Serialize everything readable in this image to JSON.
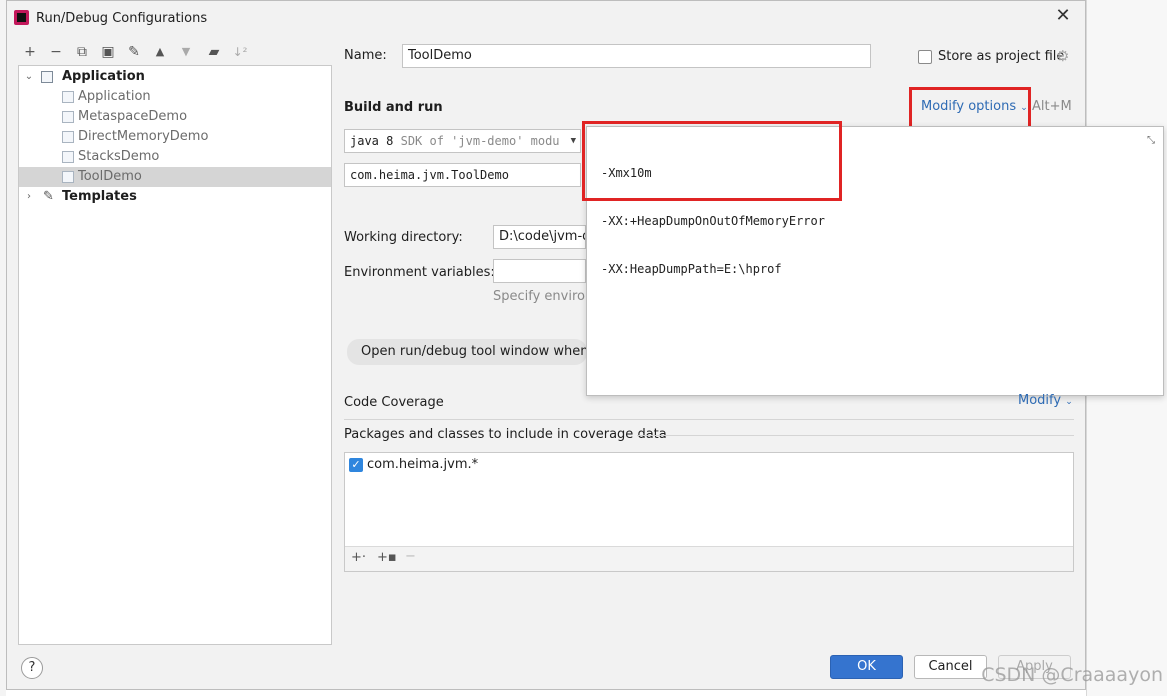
{
  "window": {
    "title": "Run/Debug Configurations",
    "close_glyph": "✕"
  },
  "toolbar": {
    "add": "+",
    "remove": "−",
    "copy": "⧉",
    "save": "▣",
    "edit": "✎",
    "up": "▲",
    "down": "▼",
    "folder": "▰",
    "sort": "↓²"
  },
  "tree": {
    "root_label": "Application",
    "children": [
      "Application",
      "MetaspaceDemo",
      "DirectMemoryDemo",
      "StacksDemo",
      "ToolDemo"
    ],
    "templates_label": "Templates"
  },
  "form": {
    "name_label": "Name:",
    "name_value": "ToolDemo",
    "store_label": "Store as project file",
    "build_run_title": "Build and run",
    "modify_options_label": "Modify options",
    "modify_options_shortcut": "Alt+M",
    "sdk_value": "java 8",
    "sdk_suffix": "SDK of 'jvm-demo' modu",
    "main_class": "com.heima.jvm.ToolDemo",
    "working_dir_label": "Working directory:",
    "working_dir_value": "D:\\code\\jvm-d",
    "env_label": "Environment variables:",
    "env_hint": "Specify environ",
    "open_tool_window": "Open run/debug tool window when sta",
    "coverage_title": "Code Coverage",
    "coverage_modify": "Modify",
    "packages_title": "Packages and classes to include in coverage data",
    "package_item": "com.heima.jvm.*"
  },
  "vm_popup": {
    "lines": [
      "-Xmx10m",
      "-XX:+HeapDumpOnOutOfMemoryError",
      "-XX:HeapDumpPath=E:\\hprof"
    ]
  },
  "buttons": {
    "ok": "OK",
    "cancel": "Cancel",
    "apply": "Apply",
    "help": "?"
  },
  "watermark": "CSDN @Craaaayon",
  "colors": {
    "accent": "#3574cf",
    "highlight_red": "#e02424",
    "link": "#2e6bb4"
  }
}
